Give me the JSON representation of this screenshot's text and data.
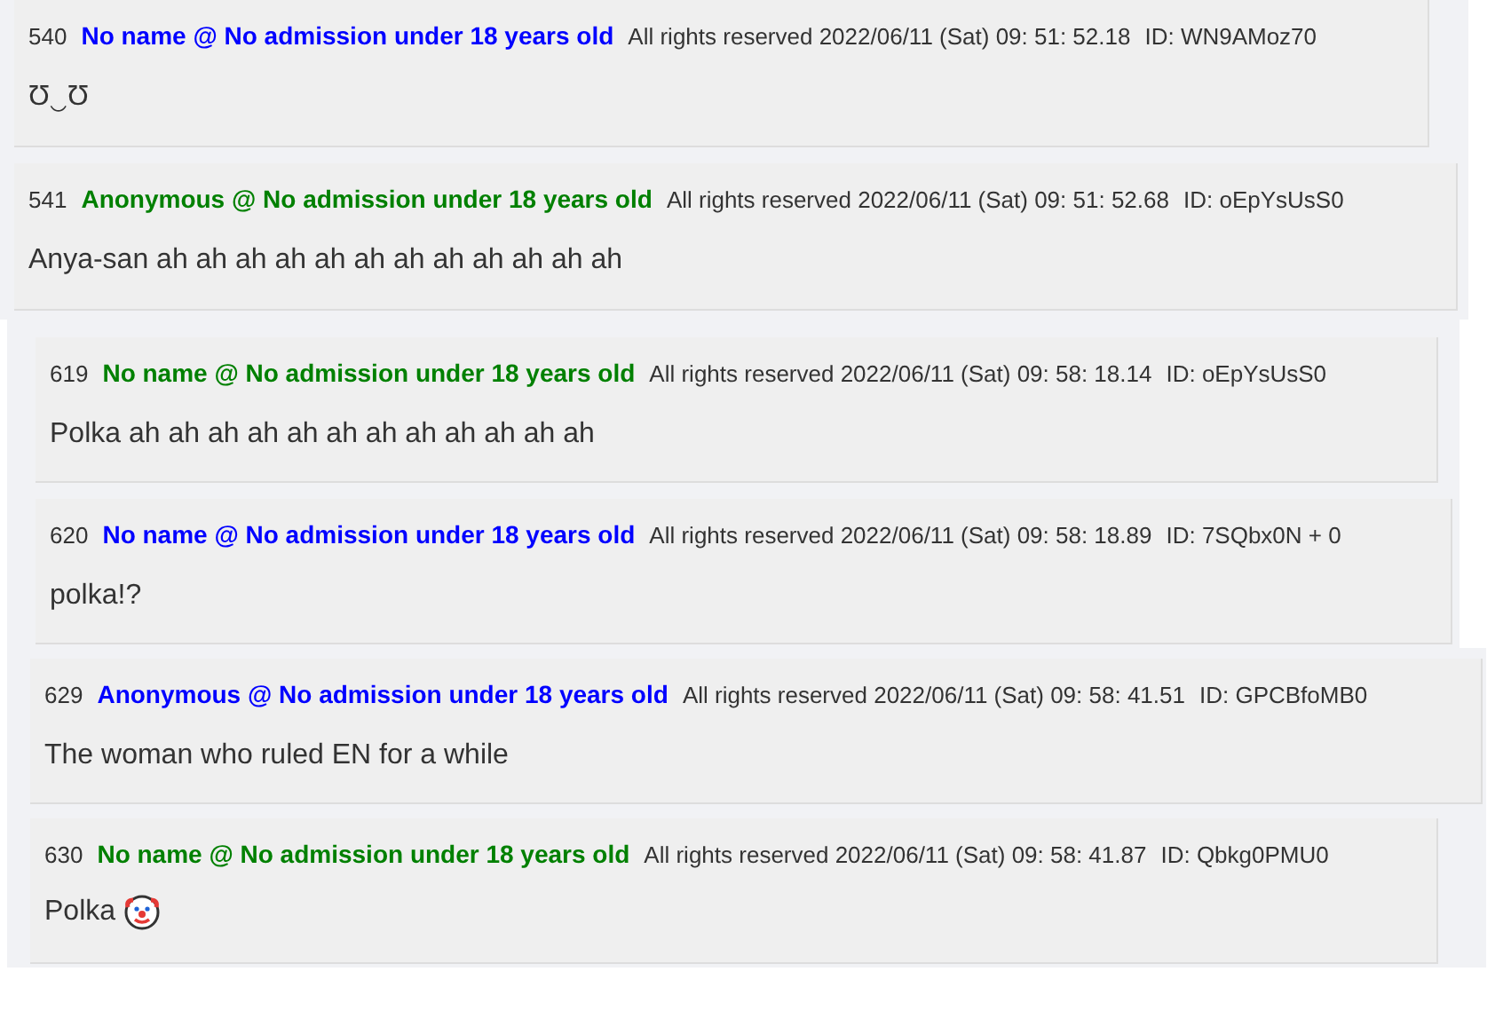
{
  "threads": [
    {
      "posts": [
        {
          "number": "540",
          "name": "No name @ No admission under 18 years old",
          "color": "#0000ff",
          "date": "All rights reserved 2022/06/11 (Sat) 09: 51: 52.18",
          "id": "ID: WN9AMoz70",
          "kind": "text",
          "body": "Ʊ‿Ʊ"
        },
        {
          "number": "541",
          "name": "Anonymous @ No admission under 18 years old",
          "color": "#008000",
          "date": "All rights reserved 2022/06/11 (Sat) 09: 51: 52.68",
          "id": "ID: oEpYsUsS0",
          "kind": "text",
          "body": "Anya-san ah ah ah ah ah ah ah ah ah ah ah ah"
        }
      ]
    },
    {
      "posts": [
        {
          "number": "619",
          "name": "No name @ No admission under 18 years old",
          "color": "#008000",
          "date": "All rights reserved 2022/06/11 (Sat) 09: 58: 18.14",
          "id": "ID: oEpYsUsS0",
          "kind": "text",
          "body": "Polka ah ah ah ah ah ah ah ah ah ah ah ah"
        },
        {
          "number": "620",
          "name": "No name @ No admission under 18 years old",
          "color": "#0000ff",
          "date": "All rights reserved 2022/06/11 (Sat) 09: 58: 18.89",
          "id": "ID: 7SQbx0N + 0",
          "kind": "text",
          "body": "polka!?"
        }
      ]
    },
    {
      "posts": [
        {
          "number": "629",
          "name": "Anonymous @ No admission under 18 years old",
          "color": "#0000ff",
          "date": "All rights reserved 2022/06/11 (Sat) 09: 58: 41.51",
          "id": "ID: GPCBfoMB0",
          "kind": "text",
          "body": "The woman who ruled EN for a while"
        },
        {
          "number": "630",
          "name": "No name @ No admission under 18 years old",
          "color": "#008000",
          "date": "All rights reserved 2022/06/11 (Sat) 09: 58: 41.87",
          "id": "ID: Qbkg0PMU0",
          "kind": "text_icon",
          "body": "Polka"
        }
      ]
    }
  ]
}
